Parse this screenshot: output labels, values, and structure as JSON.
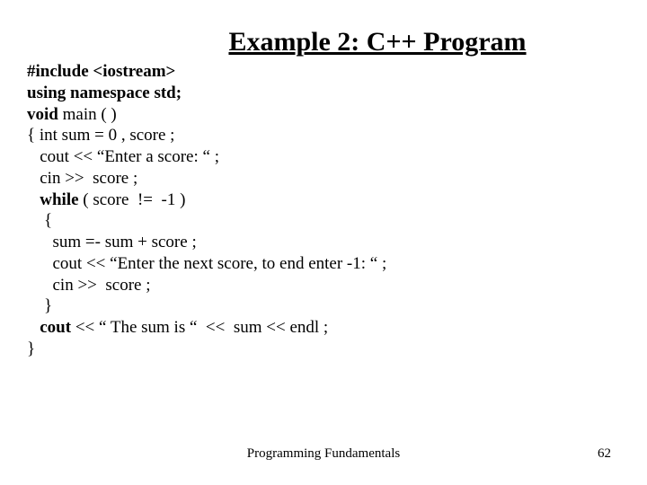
{
  "title": "Example 2: C++ Program",
  "code": {
    "l1a": "#include <iostream>",
    "l2a": "using namespace std;",
    "l3a": "void",
    "l3b": " main ( )",
    "l4": "{ int sum = 0 , score ;",
    "l5": "   cout << “Enter a score: “ ;",
    "l6": "   cin >>  score ;",
    "l7a": "   while",
    "l7b": " ( score  !=  -1 )",
    "l8": "    {",
    "l9": "      sum =- sum + score ;",
    "l10": "      cout << “Enter the next score, to end enter -1: “ ;",
    "l11": "      cin >>  score ;",
    "l12": "    }",
    "l13a": "   cout",
    "l13b": " << “ The sum is “  <<  sum << endl ;",
    "l14": "}"
  },
  "footer": {
    "center": "Programming Fundamentals",
    "page": "62"
  }
}
